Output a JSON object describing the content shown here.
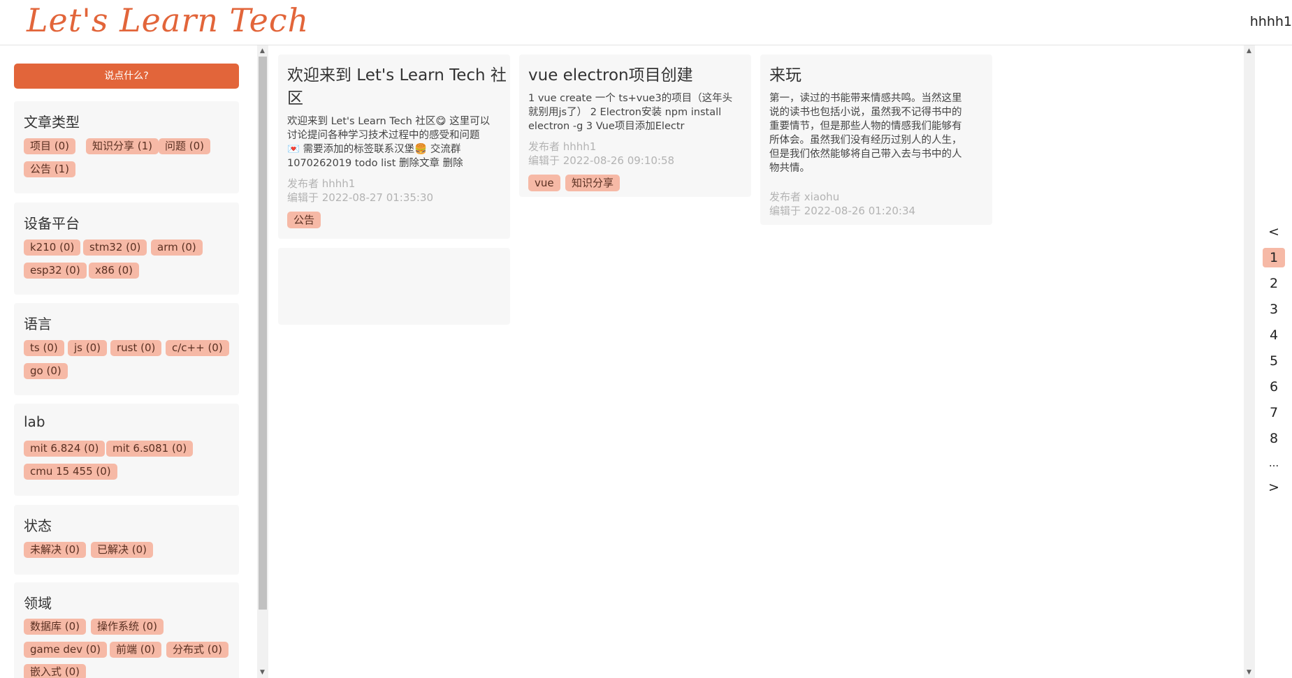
{
  "header": {
    "logo": "Let's  Learn  Tech",
    "username": "hhhh1"
  },
  "sidebar": {
    "say_button": "说点什么?",
    "categories": [
      {
        "title": "文章类型",
        "chips": [
          "项目 (0)",
          "知识分享 (1)",
          "问题 (0)",
          "公告 (1)"
        ]
      },
      {
        "title": "设备平台",
        "chips": [
          "k210 (0)",
          "stm32 (0)",
          "arm (0)",
          "esp32 (0)",
          "x86 (0)"
        ]
      },
      {
        "title": "语言",
        "chips": [
          "ts (0)",
          "js (0)",
          "rust (0)",
          "c/c++ (0)",
          "go (0)"
        ]
      },
      {
        "title": "lab",
        "chips": [
          "mit 6.824 (0)",
          "mit 6.s081 (0)",
          "cmu 15 455 (0)"
        ]
      },
      {
        "title": "状态",
        "chips": [
          "未解决 (0)",
          "已解决 (0)"
        ]
      },
      {
        "title": "领域",
        "chips": [
          "数据库 (0)",
          "操作系统 (0)",
          "game dev (0)",
          "前端 (0)",
          "分布式 (0)",
          "嵌入式 (0)"
        ]
      }
    ]
  },
  "posts": [
    {
      "title_line1": "欢迎来到 Let's Learn Tech 社",
      "title_line2": "区",
      "body": [
        "欢迎来到 Let's Learn Tech 社区😋 这里可以",
        "讨论提问各种学习技术过程中的感受和问题",
        "💌 需要添加的标签联系汉堡🍔 交流群",
        "1070262019 todo list 删除文章 删除"
      ],
      "author": "发布者 hhhh1",
      "edited": "编辑于 2022-08-27 01:35:30",
      "tags": [
        "公告"
      ]
    },
    {
      "title_line1": "vue electron项目创建",
      "body": [
        "1 vue create 一个 ts+vue3的项目（这年头",
        "就别用js了） 2 Electron安装 npm install",
        "electron -g 3 Vue项目添加Electr"
      ],
      "author": "发布者 hhhh1",
      "edited": "编辑于 2022-08-26 09:10:58",
      "tags": [
        "vue",
        "知识分享"
      ]
    },
    {
      "title_line1": "来玩",
      "body": [
        "第一，读过的书能带来情感共鸣。当然这里",
        "说的读书也包括小说，虽然我不记得书中的",
        "重要情节，但是那些人物的情感我们能够有",
        "所体会。虽然我们没有经历过别人的人生，",
        "但是我们依然能够将自己带入去与书中的人",
        "物共情。"
      ],
      "author": "发布者 xiaohu",
      "edited": "编辑于 2022-08-26 01:20:34",
      "tags": []
    }
  ],
  "pagination": {
    "prev": "<",
    "pages": [
      "1",
      "2",
      "3",
      "4",
      "5",
      "6",
      "7",
      "8"
    ],
    "ellipsis": "...",
    "next": ">",
    "current": "1"
  },
  "colors": {
    "accent": "#e2653a",
    "chip_bg": "#f6b9a6",
    "card_bg": "#f7f7f7"
  }
}
